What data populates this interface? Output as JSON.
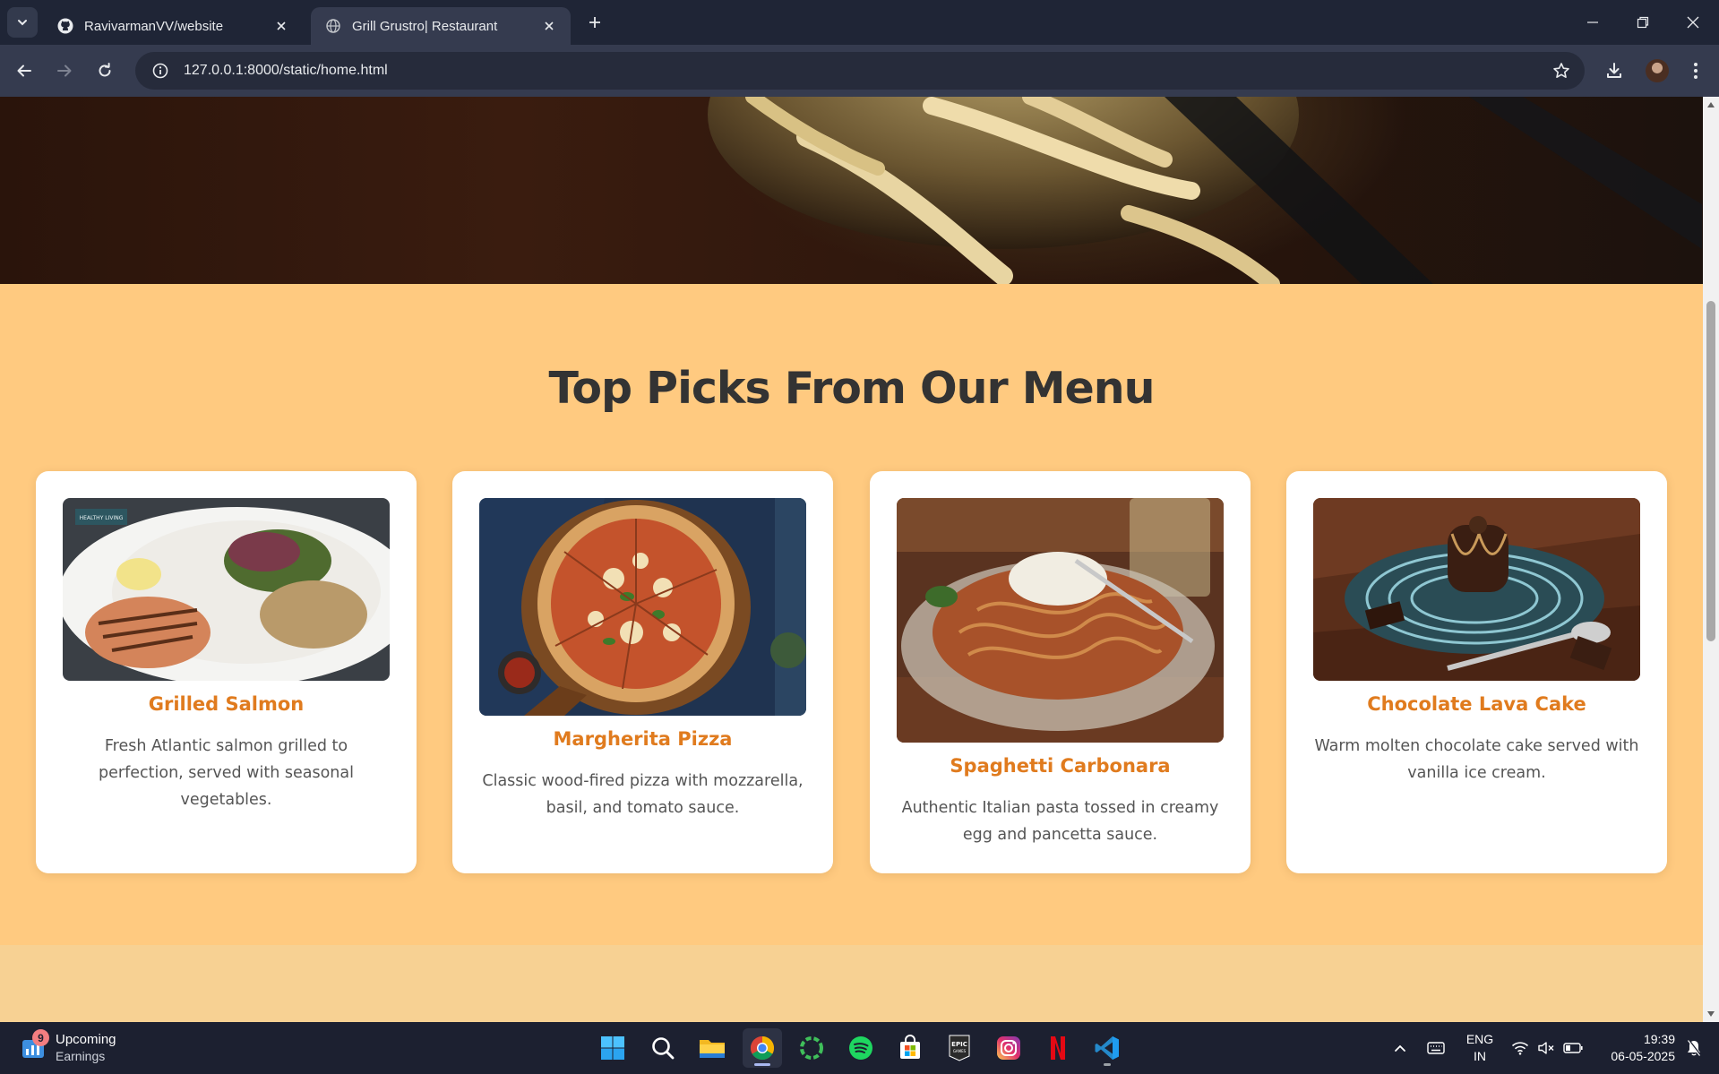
{
  "browser": {
    "tabs": [
      {
        "title": "RavivarmanVV/website",
        "icon": "github-icon",
        "active": false
      },
      {
        "title": "Grill Grustro| Restaurant",
        "icon": "globe-icon",
        "active": true
      }
    ],
    "url": "127.0.0.1:8000/static/home.html"
  },
  "page": {
    "section_title": "Top Picks From Our Menu",
    "menu_items": [
      {
        "name": "Grilled Salmon",
        "description": "Fresh Atlantic salmon grilled to perfection, served with seasonal vegetables.",
        "image_badge": "HEALTHY LIVING"
      },
      {
        "name": "Margherita Pizza",
        "description": "Classic wood-fired pizza with mozzarella, basil, and tomato sauce."
      },
      {
        "name": "Spaghetti Carbonara",
        "description": "Authentic Italian pasta tossed in creamy egg and pancetta sauce."
      },
      {
        "name": "Chocolate Lava Cake",
        "description": "Warm molten chocolate cake served with vanilla ice cream."
      }
    ],
    "colors": {
      "section_bg": "#ffca80",
      "card_title": "#e07b1e",
      "heading": "#333333"
    }
  },
  "taskbar": {
    "widget": {
      "title": "Upcoming",
      "subtitle": "Earnings",
      "badge": "9"
    },
    "apps": [
      "windows-start-icon",
      "search-icon",
      "file-explorer-icon",
      "chrome-icon",
      "circle-app-icon",
      "spotify-icon",
      "microsoft-store-icon",
      "epic-games-icon",
      "instagram-icon",
      "netflix-icon",
      "vscode-icon"
    ],
    "epic_label": "EPIC GAMES",
    "language": {
      "line1": "ENG",
      "line2": "IN"
    },
    "time": "19:39",
    "date": "06-05-2025"
  }
}
